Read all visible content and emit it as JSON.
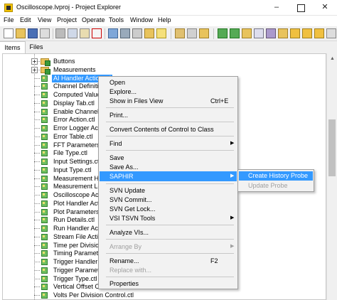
{
  "window": {
    "title": "Oscilloscope.lvproj - Project Explorer",
    "minimize_glyph": "–",
    "close_glyph": "✕"
  },
  "menubar": [
    "File",
    "Edit",
    "View",
    "Project",
    "Operate",
    "Tools",
    "Window",
    "Help"
  ],
  "tabs": [
    "Items",
    "Files"
  ],
  "tree": [
    {
      "label": "Buttons",
      "kind": "folder"
    },
    {
      "label": "Measurements",
      "kind": "folder"
    },
    {
      "label": "AI Handler Action.ctl",
      "kind": "ctl"
    },
    {
      "label": "Channel Definition.ctl",
      "kind": "ctl"
    },
    {
      "label": "Computed Value Enum.ctl",
      "kind": "ctl"
    },
    {
      "label": "Display Tab.ctl",
      "kind": "ctl"
    },
    {
      "label": "Enable Channel.ctl",
      "kind": "ctl"
    },
    {
      "label": "Error Action.ctl",
      "kind": "ctl"
    },
    {
      "label": "Error Logger Action.ctl",
      "kind": "ctl"
    },
    {
      "label": "Error Table.ctl",
      "kind": "ctl"
    },
    {
      "label": "FFT Parameters.ctl",
      "kind": "ctl"
    },
    {
      "label": "File Type.ctl",
      "kind": "ctl"
    },
    {
      "label": "Input Settings.ctl",
      "kind": "ctl"
    },
    {
      "label": "Input Type.ctl",
      "kind": "ctl"
    },
    {
      "label": "Measurement Handler.ctl",
      "kind": "ctl"
    },
    {
      "label": "Measurement Log.ctl",
      "kind": "ctl"
    },
    {
      "label": "Oscilloscope Action.ctl",
      "kind": "ctl"
    },
    {
      "label": "Plot Handler Action.ctl",
      "kind": "ctl"
    },
    {
      "label": "Plot Parameters.ctl",
      "kind": "ctl"
    },
    {
      "label": "Run Details.ctl",
      "kind": "ctl"
    },
    {
      "label": "Run Handler Action.ctl",
      "kind": "ctl"
    },
    {
      "label": "Stream File Action.ctl",
      "kind": "ctl"
    },
    {
      "label": "Time per Division.ctl",
      "kind": "ctl"
    },
    {
      "label": "Timing Parameters.ctl",
      "kind": "ctl"
    },
    {
      "label": "Trigger Handler Action.ctl",
      "kind": "ctl"
    },
    {
      "label": "Trigger Parameters.ctl",
      "kind": "ctl"
    },
    {
      "label": "Trigger Type.ctl",
      "kind": "ctl"
    },
    {
      "label": "Vertical Offset Control.ctl",
      "kind": "ctl"
    },
    {
      "label": "Volts Per Division Control.ctl",
      "kind": "ctl"
    }
  ],
  "context_menu": {
    "open": "Open",
    "explore": "Explore...",
    "show_in_files": "Show in Files View",
    "show_in_files_shortcut": "Ctrl+E",
    "print": "Print...",
    "convert": "Convert Contents of Control to Class",
    "find": "Find",
    "save": "Save",
    "save_as": "Save As...",
    "saphir": "SAPHIR",
    "svn_update": "SVN Update",
    "svn_commit": "SVN Commit...",
    "svn_get_lock": "SVN Get Lock...",
    "vsi_tsvn": "VSI TSVN Tools",
    "analyze": "Analyze VIs...",
    "arrange_by": "Arrange By",
    "rename": "Rename...",
    "rename_shortcut": "F2",
    "replace_with": "Replace with...",
    "properties": "Properties"
  },
  "submenu": {
    "create_history_probe": "Create History Probe",
    "update_probe": "Update Probe"
  },
  "colors": {
    "selection": "#3399ff",
    "menu_bg": "#f2f2f2",
    "disabled_text": "#a0a0a0"
  }
}
